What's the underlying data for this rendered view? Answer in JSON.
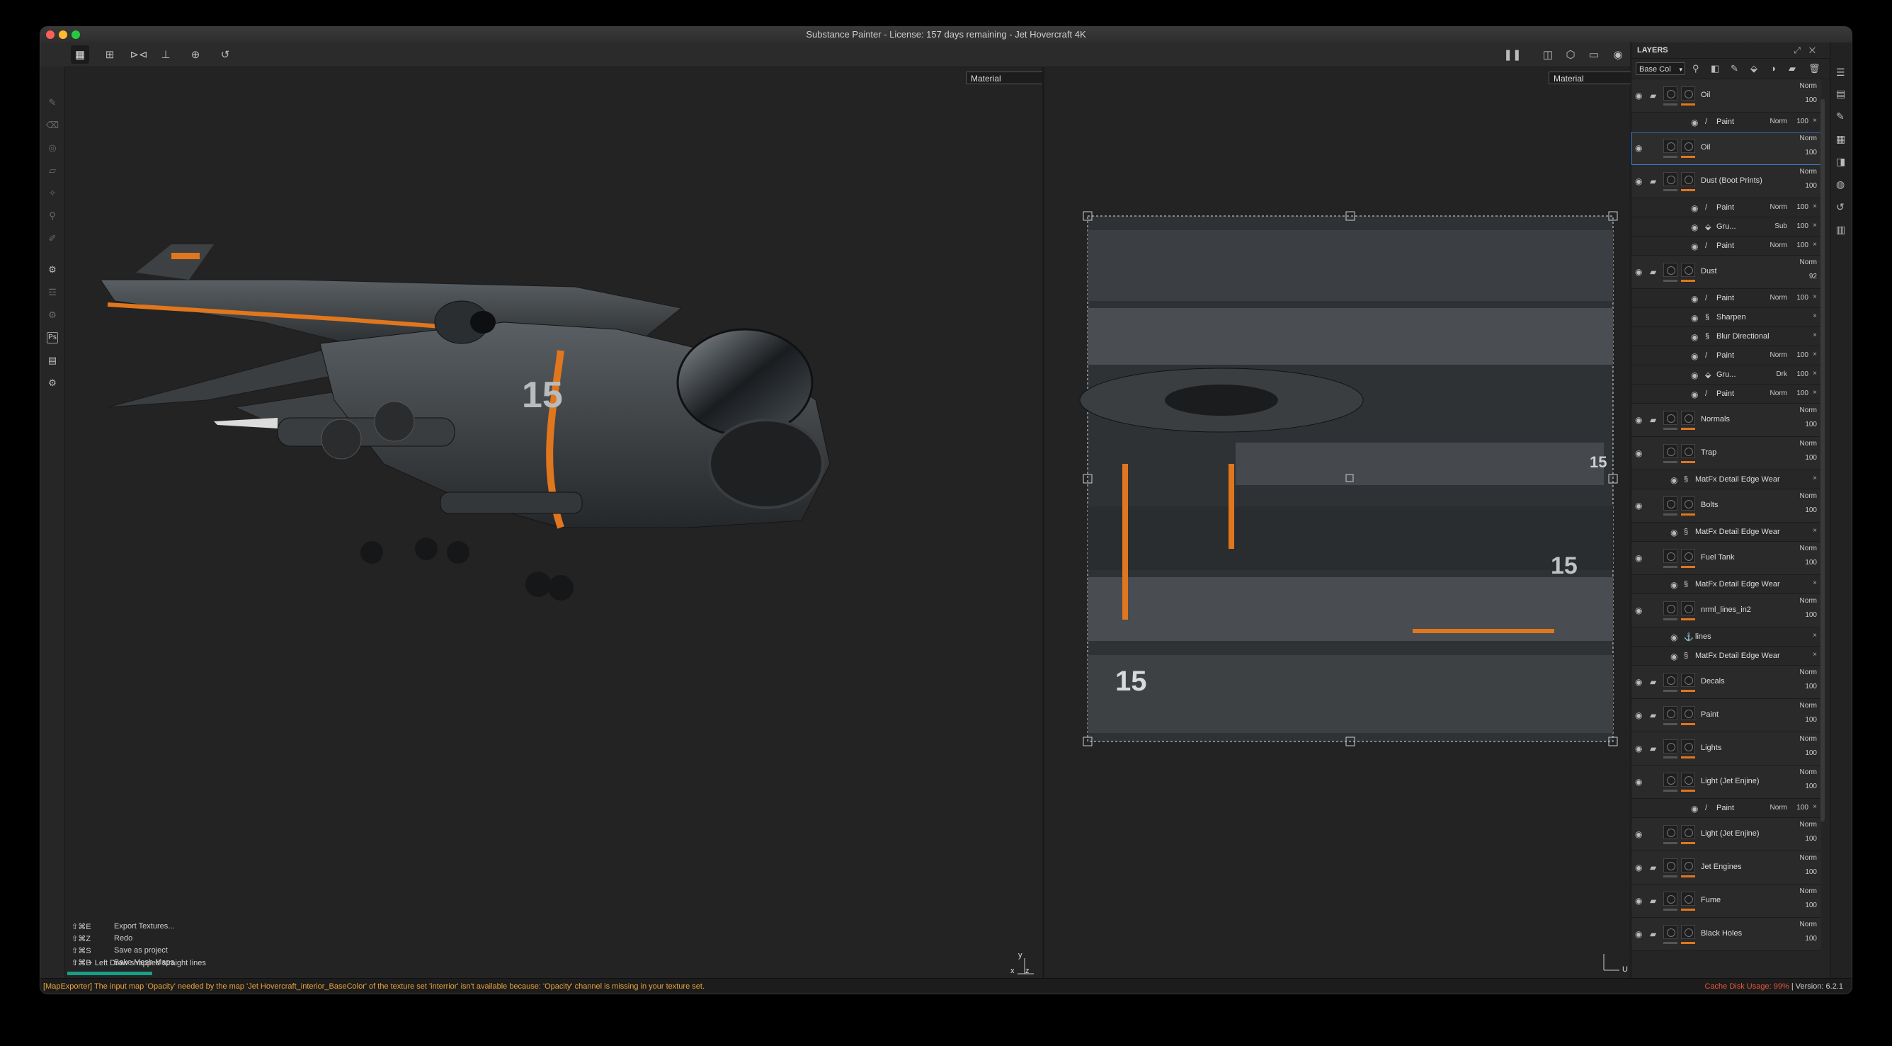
{
  "window": {
    "title": "Substance Painter - License: 157 days remaining - Jet Hovercraft 4K"
  },
  "viewport3d": {
    "dropdown": "Material"
  },
  "viewport2d": {
    "dropdown": "Material"
  },
  "shortcuts": [
    {
      "key": "⇧⌘E",
      "label": "Export Textures..."
    },
    {
      "key": "⇧⌘Z",
      "label": "Redo"
    },
    {
      "key": "⇧⌘S",
      "label": "Save as project"
    },
    {
      "key": "⇧⌘B",
      "label": "Bake Mesh Maps"
    }
  ],
  "hint": "⇧⌘ + Left  Draw snapped straight lines",
  "gizmo3d": {
    "x": "x",
    "y": "y",
    "z": "z"
  },
  "gizmo2d": {
    "u": "U"
  },
  "status": {
    "message": "[MapExporter] The input map 'Opacity' needed by the map 'Jet Hovercraft_interior_BaseColor' of the texture set 'interrior' isn't available because: 'Opacity' channel is missing in your texture set.",
    "cache_label": "Cache Disk Usage:",
    "cache_value": "99%",
    "version": "| Version: 6.2.1"
  },
  "layers": {
    "title": "LAYERS",
    "channel": "Base Col",
    "items": [
      {
        "type": "big",
        "name": "Oil",
        "blend": "Norm",
        "opacity": "100",
        "folder": true
      },
      {
        "type": "sub",
        "name": "Paint",
        "blend": "Norm",
        "opacity": "100",
        "icon": "brush"
      },
      {
        "type": "big",
        "name": "Oil",
        "blend": "Norm",
        "opacity": "100",
        "selected": true
      },
      {
        "type": "big",
        "name": "Dust (Boot Prints)",
        "blend": "Norm",
        "opacity": "100",
        "folder": true
      },
      {
        "type": "sub",
        "name": "Paint",
        "blend": "Norm",
        "opacity": "100",
        "icon": "brush"
      },
      {
        "type": "sub",
        "name": "Gru...",
        "blend": "Sub",
        "opacity": "100",
        "icon": "fill"
      },
      {
        "type": "sub",
        "name": "Paint",
        "blend": "Norm",
        "opacity": "100",
        "icon": "brush"
      },
      {
        "type": "big",
        "name": "Dust",
        "blend": "Norm",
        "opacity": "92",
        "folder": true
      },
      {
        "type": "sub",
        "name": "Paint",
        "blend": "Norm",
        "opacity": "100",
        "icon": "brush"
      },
      {
        "type": "sub",
        "name": "Sharpen",
        "blend": "",
        "opacity": "",
        "icon": "filter"
      },
      {
        "type": "sub",
        "name": "Blur Directional",
        "blend": "",
        "opacity": "",
        "icon": "filter"
      },
      {
        "type": "sub",
        "name": "Paint",
        "blend": "Norm",
        "opacity": "100",
        "icon": "brush"
      },
      {
        "type": "sub",
        "name": "Gru...",
        "blend": "Drk",
        "opacity": "100",
        "icon": "fill"
      },
      {
        "type": "sub",
        "name": "Paint",
        "blend": "Norm",
        "opacity": "100",
        "icon": "brush"
      },
      {
        "type": "big",
        "name": "Normals",
        "blend": "Norm",
        "opacity": "100",
        "folder": true
      },
      {
        "type": "big",
        "name": "Trap",
        "blend": "Norm",
        "opacity": "100"
      },
      {
        "type": "sub",
        "name": "MatFx Detail Edge Wear",
        "blend": "",
        "opacity": "",
        "icon": "filter",
        "indent": true
      },
      {
        "type": "big",
        "name": "Bolts",
        "blend": "Norm",
        "opacity": "100"
      },
      {
        "type": "sub",
        "name": "MatFx Detail Edge Wear",
        "blend": "",
        "opacity": "",
        "icon": "filter",
        "indent": true
      },
      {
        "type": "big",
        "name": "Fuel Tank",
        "blend": "Norm",
        "opacity": "100"
      },
      {
        "type": "sub",
        "name": "MatFx Detail Edge Wear",
        "blend": "",
        "opacity": "",
        "icon": "filter",
        "indent": true
      },
      {
        "type": "big",
        "name": "nrml_lines_in2",
        "blend": "Norm",
        "opacity": "100"
      },
      {
        "type": "sub",
        "name": "lines",
        "blend": "",
        "opacity": "",
        "icon": "anchor",
        "indent": true
      },
      {
        "type": "sub",
        "name": "MatFx Detail Edge Wear",
        "blend": "",
        "opacity": "",
        "icon": "filter",
        "indent": true
      },
      {
        "type": "big",
        "name": "Decals",
        "blend": "Norm",
        "opacity": "100",
        "folder": true
      },
      {
        "type": "big",
        "name": "Paint",
        "blend": "Norm",
        "opacity": "100",
        "folder": true
      },
      {
        "type": "big",
        "name": "Lights",
        "blend": "Norm",
        "opacity": "100",
        "folder": true
      },
      {
        "type": "big",
        "name": "Light (Jet Enjine)",
        "blend": "Norm",
        "opacity": "100"
      },
      {
        "type": "sub",
        "name": "Paint",
        "blend": "Norm",
        "opacity": "100",
        "icon": "brush"
      },
      {
        "type": "big",
        "name": "Light (Jet Enjine)",
        "blend": "Norm",
        "opacity": "100"
      },
      {
        "type": "big",
        "name": "Jet Engines",
        "blend": "Norm",
        "opacity": "100",
        "folder": true
      },
      {
        "type": "big",
        "name": "Fume",
        "blend": "Norm",
        "opacity": "100",
        "folder": true
      },
      {
        "type": "big",
        "name": "Black Holes",
        "blend": "Norm",
        "opacity": "100",
        "folder": true
      }
    ]
  },
  "colors": {
    "accent": "#e0761d",
    "selection": "#3d7bd5",
    "warning": "#e8a23a",
    "progress": "#1a9e86"
  }
}
